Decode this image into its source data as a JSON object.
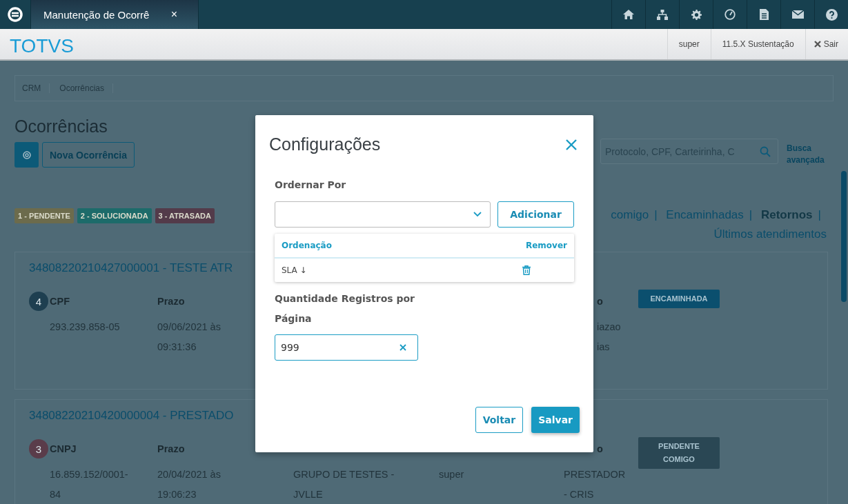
{
  "top_bar": {
    "tab": {
      "label": "Manutenção de Ocorrê",
      "close": "×",
      "selected": true
    }
  },
  "header": {
    "logo": "TOTVS",
    "user": "super",
    "environment": "11.5.X Sustentação",
    "logout": "Sair"
  },
  "breadcrumb": [
    "CRM",
    "Ocorrências"
  ],
  "page": {
    "title": "Ocorrências",
    "new_button": "Nova Ocorrência",
    "search_placeholder": "Protocolo, CPF, Carteirinha, C",
    "advanced_search": "Busca avançada",
    "legend": [
      {
        "label": "1 - PENDENTE",
        "color": "#6c6b4c"
      },
      {
        "label": "2 - SOLUCIONADA",
        "color": "#1d6b6a"
      },
      {
        "label": "3 - ATRASADA",
        "color": "#533b4a"
      }
    ],
    "separator": "|",
    "filter_links": [
      {
        "label": "comigo",
        "selected": false
      },
      {
        "label": "Encaminhadas",
        "selected": false
      },
      {
        "label": "Retornos",
        "selected": true
      },
      {
        "label": "Últimos atendimentos",
        "selected": false
      }
    ]
  },
  "cards": [
    {
      "title": "34808220210427000001 - TESTE ATR",
      "number": "4",
      "color": "#1e3f50",
      "status": {
        "label": "ENCAMINHADA",
        "color": "#0b4f6e"
      },
      "fields": [
        {
          "kind": "full",
          "label": "CPF",
          "value": "293.239.858-05"
        },
        {
          "kind": "full",
          "label": "Prazo",
          "value": "09/06/2021 às 09:31:36"
        },
        {
          "kind": "hidden"
        },
        {
          "kind": "hidden"
        },
        {
          "kind": "clipped",
          "label": "o",
          "value": "iazao ias"
        }
      ]
    },
    {
      "title": "34808220210420000004 - PRESTADO",
      "number": "3",
      "color": "#5a3c4a",
      "status": {
        "label": "PENDENTE COMIGO",
        "color": "#2a4754"
      },
      "fields": [
        {
          "kind": "full",
          "label": "CNPJ",
          "value": "16.859.152/0001-84"
        },
        {
          "kind": "full",
          "label": "Prazo",
          "value": "20/04/2021 às 19:06:23"
        },
        {
          "kind": "full",
          "value": "GRUPO DE TESTES - JVLLE"
        },
        {
          "kind": "full",
          "value": "super"
        },
        {
          "kind": "clipped_label",
          "label": "o",
          "value": "PRESTADOR - CRIS"
        }
      ]
    }
  ],
  "modal": {
    "title": "Configurações",
    "order_label": "Ordernar Por",
    "add_button": "Adicionar",
    "table": {
      "columns": [
        "Ordenação",
        "Remover"
      ],
      "rows": [
        {
          "label": "SLA ↓"
        }
      ]
    },
    "quantity_label": "Quantidade Registros por Página",
    "quantity_value": "999",
    "buttons": [
      {
        "label": "Voltar",
        "kind": "secondary"
      },
      {
        "label": "Salvar",
        "kind": "primary"
      }
    ]
  }
}
